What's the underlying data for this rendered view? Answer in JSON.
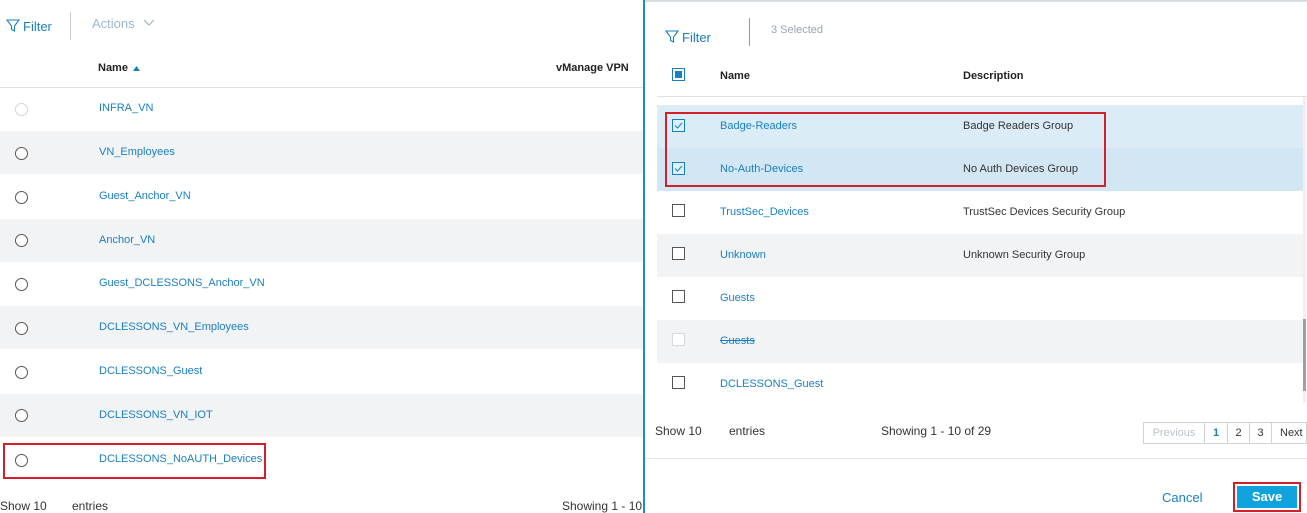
{
  "left": {
    "filter_label": "Filter",
    "actions_label": "Actions",
    "col_name": "Name",
    "col_vpn": "vManage VPN",
    "rows": [
      "INFRA_VN",
      "VN_Employees",
      "Guest_Anchor_VN",
      "Anchor_VN",
      "Guest_DCLESSONS_Anchor_VN",
      "DCLESSONS_VN_Employees",
      "DCLESSONS_Guest",
      "DCLESSONS_VN_IOT",
      "DCLESSONS_NoAUTH_Devices"
    ],
    "show_label": "Show 10",
    "entries_label": "entries",
    "showing_label": "Showing 1 - 10"
  },
  "right": {
    "filter_label": "Filter",
    "selected_label": "3 Selected",
    "col_name": "Name",
    "col_desc": "Description",
    "rows": [
      {
        "name": "Badge-Readers",
        "desc": "Badge Readers Group"
      },
      {
        "name": "No-Auth-Devices",
        "desc": "No Auth Devices Group"
      },
      {
        "name": "TrustSec_Devices",
        "desc": "TrustSec Devices Security Group"
      },
      {
        "name": "Unknown",
        "desc": "Unknown Security Group"
      },
      {
        "name": "Guests",
        "desc": ""
      },
      {
        "name": "Guests",
        "desc": ""
      },
      {
        "name": "DCLESSONS_Guest",
        "desc": ""
      }
    ],
    "show_label": "Show 10",
    "entries_label": "entries",
    "showing_label": "Showing 1 - 10 of 29",
    "pagination": {
      "previous": "Previous",
      "pages": [
        "1",
        "2",
        "3"
      ],
      "next": "Next"
    },
    "cancel_label": "Cancel",
    "save_label": "Save"
  },
  "colors": {
    "accent": "#1a7fc1",
    "highlight": "#d0202a",
    "save_bg": "#10a2dc"
  },
  "icons": [
    "filter-icon",
    "chevron-down-icon",
    "sort-asc-icon",
    "radio-icon",
    "checkbox-icon"
  ]
}
